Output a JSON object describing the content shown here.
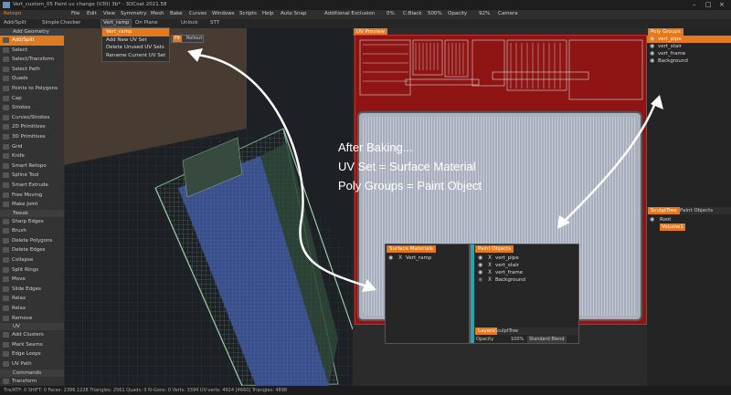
{
  "window": {
    "title": "Vert_custom_05 Paint uv change (V30) 3b* - 3DCoat 2021.58"
  },
  "menu": [
    "Retopo",
    "File",
    "Edit",
    "View",
    "Symmetry",
    "Mesh",
    "Bake",
    "Curves",
    "Windows",
    "Scripts",
    "Help",
    "Auto Snap",
    "Additional Exclusion",
    "0%",
    "C:Black",
    "500%",
    "Opacity",
    "92%",
    "Camera"
  ],
  "toolbar": {
    "items": [
      "Add/Split",
      "Simple",
      "Checker"
    ],
    "uvset_dropdown": "Vert_ramp",
    "on_plane": "On Plane",
    "unlock": "Unlock",
    "stt": "STT",
    "fit_label": "Fit",
    "rollout_label": "Rollout"
  },
  "popup": {
    "items": [
      "Vert_ramp",
      "Add New UV Set",
      "Delete Unused UV Sets",
      "Rename Current UV Set"
    ]
  },
  "left_panel": {
    "sections": [
      {
        "head": "Add Geometry",
        "items": [
          "Add/Split",
          "Select",
          "Select/Transform",
          "Select Path",
          "Quads",
          "Points to Polygons",
          "Cap",
          "Strokes",
          "Curves/Strokes",
          "2D Primitives",
          "3D Primitives",
          "Grid",
          "Knife",
          "Smart Retopo",
          "Spline Tool",
          "Smart Extrude",
          "Free Moving",
          "Make Joint"
        ]
      },
      {
        "head": "Tweak",
        "items": [
          "Sharp Edges",
          "Brush",
          "Delete Polygons",
          "Delete Edges",
          "Collapse",
          "Split Rings",
          "Move",
          "Slide Edges",
          "Relax",
          "Relax",
          "Remove"
        ]
      },
      {
        "head": "UV",
        "items": [
          "Add Clusters",
          "Mark Seams",
          "Edge Loops",
          "UV Path"
        ]
      },
      {
        "head": "Commands",
        "items": [
          "Transform"
        ]
      }
    ],
    "selected": "Add/Split"
  },
  "uv_preview": {
    "tab": "UV Preview"
  },
  "poly_groups_panel": {
    "tab": "Poly Groups",
    "items": [
      "vert_pipe",
      "vert_stair",
      "vert_frame",
      "Background"
    ],
    "selected": "vert_pipe"
  },
  "sculpt_panel": {
    "tabs": [
      "SculptTree",
      "Paint Objects"
    ],
    "rows": [
      "Root",
      "Volume1"
    ]
  },
  "annotation": {
    "line1": "After Baking...",
    "line2": "UV Set = Surface Material",
    "line3": "Poly Groups = Paint Object"
  },
  "surface_materials": {
    "tab": "Surface Materials",
    "items": [
      "Vert_ramp"
    ]
  },
  "paint_objects": {
    "tab": "Paint Objects",
    "items": [
      "vert_pipe",
      "vert_stair",
      "vert_frame",
      "Background"
    ],
    "footer_tabs": [
      "Layers",
      "SculptTree"
    ],
    "opacity_label": "Opacity",
    "opacity_value": "100%",
    "blend": "Standard Blend"
  },
  "status": {
    "text": "Tris/RTF: 0  SHIFT: 0  Faces: 2396 1228  Triangles: 2561  Quads: 0  N-Gons: 0  Verts: 3394    UV-verts: 4924 [4660]  Triangles: 4898"
  },
  "colors": {
    "accent": "#e5791b",
    "uv_red": "#8f1414",
    "uv_blue_grey": "#aab0bd"
  }
}
